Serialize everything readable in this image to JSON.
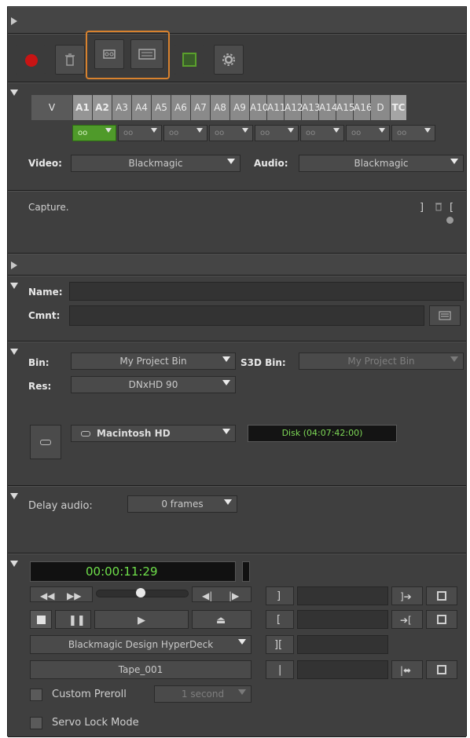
{
  "toolbar": {
    "buttons": [
      {
        "name": "record-icon",
        "color": "#c81414"
      },
      {
        "name": "trash-icon"
      },
      {
        "name": "capture-mode-icon",
        "highlighted": true
      },
      {
        "name": "capture-log-icon",
        "highlighted": true
      },
      {
        "name": "clip-color-icon",
        "color": "#5aa02c"
      },
      {
        "name": "gear-icon"
      }
    ],
    "highlight_color": "#d8822e"
  },
  "tracks": {
    "labels": [
      "V",
      "A1",
      "A2",
      "A3",
      "A4",
      "A5",
      "A6",
      "A7",
      "A8",
      "A9",
      "A10",
      "A11",
      "A12",
      "A13",
      "A14",
      "A15",
      "A16",
      "D",
      "TC"
    ],
    "pair_values": [
      "oo",
      "oo",
      "oo",
      "oo",
      "oo",
      "oo",
      "oo",
      "oo"
    ],
    "video_label": "Video:",
    "video_value": "Blackmagic",
    "audio_label": "Audio:",
    "audio_value": "Blackmagic"
  },
  "capture": {
    "status": "Capture."
  },
  "clip": {
    "name_label": "Name:",
    "name_value": "",
    "comment_label": "Cmnt:",
    "comment_value": ""
  },
  "bin": {
    "bin_label": "Bin:",
    "bin_value": "My Project Bin",
    "s3d_label": "S3D Bin:",
    "s3d_value": "My Project Bin",
    "res_label": "Res:",
    "res_value": "DNxHD 90",
    "disk_value": "Macintosh HD",
    "disk_time": "Disk (04:07:42:00)"
  },
  "delay": {
    "label": "Delay audio:",
    "value": "0 frames"
  },
  "deck": {
    "timecode": "00:00:11:29",
    "timecode_color": "#6fe04a",
    "device": "Blackmagic Design HyperDeck",
    "tape": "Tape_001",
    "custom_preroll_label": "Custom Preroll",
    "custom_preroll_value": "1 second",
    "servo_label": "Servo Lock Mode",
    "custom_preroll_checked": false,
    "servo_checked": false
  }
}
